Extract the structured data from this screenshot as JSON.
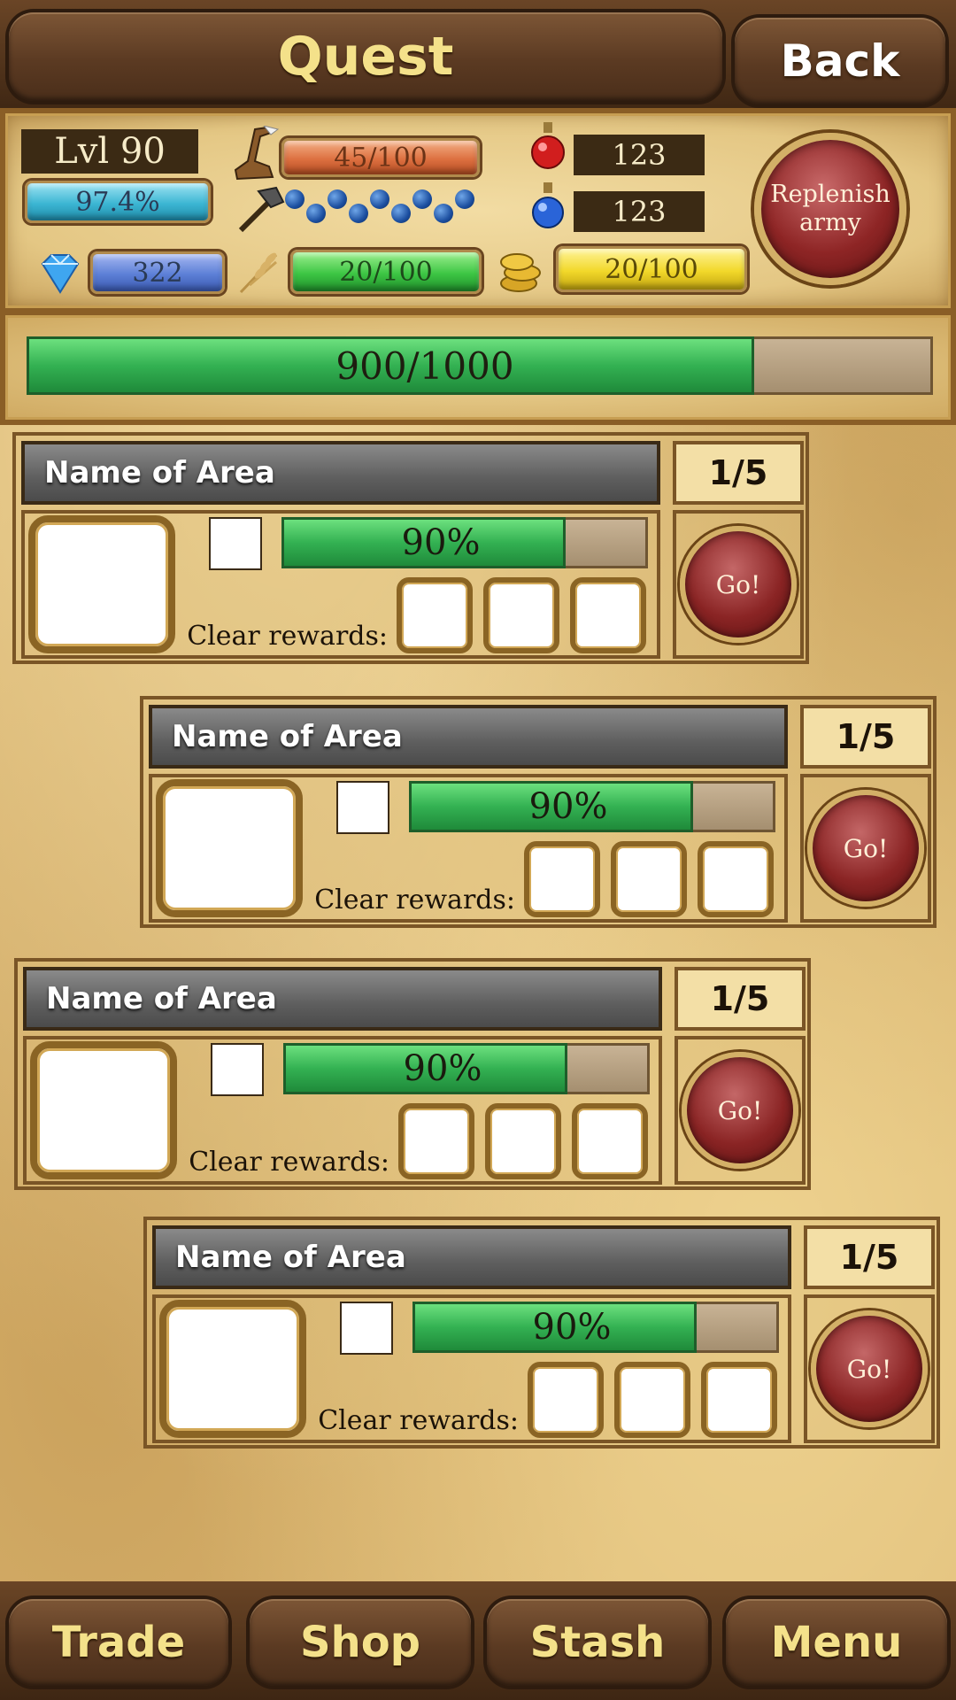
{
  "header": {
    "title": "Quest",
    "back_label": "Back"
  },
  "player": {
    "level_label": "Lvl 90",
    "experience_percent_label": "97.4%",
    "stamina": "45/100",
    "gems": "322",
    "food": "20/100",
    "gold": "20/100",
    "red_potions": "123",
    "blue_potions": "123",
    "army_units_count": 9,
    "replenish_label": "Replenish army"
  },
  "xp_bar": {
    "label": "900/1000",
    "current": 900,
    "max": 1000
  },
  "quests": [
    {
      "area_name": "Name of Area",
      "count": "1/5",
      "progress_label": "90%",
      "progress": 0.9,
      "rewards_label": "Clear rewards:",
      "go_label": "Go!"
    },
    {
      "area_name": "Name of Area",
      "count": "1/5",
      "progress_label": "90%",
      "progress": 0.9,
      "rewards_label": "Clear rewards:",
      "go_label": "Go!"
    },
    {
      "area_name": "Name of Area",
      "count": "1/5",
      "progress_label": "90%",
      "progress": 0.9,
      "rewards_label": "Clear rewards:",
      "go_label": "Go!"
    },
    {
      "area_name": "Name of Area",
      "count": "1/5",
      "progress_label": "90%",
      "progress": 0.9,
      "rewards_label": "Clear rewards:",
      "go_label": "Go!"
    }
  ],
  "bottom_nav": {
    "trade_label": "Trade",
    "shop_label": "Shop",
    "stash_label": "Stash",
    "menu_label": "Menu"
  },
  "icons": {
    "stamina": "boot-icon",
    "army": "axe-icon",
    "gems": "diamond-icon",
    "food": "wheat-icon",
    "gold": "coins-icon",
    "red_potion": "red-potion-icon",
    "blue_potion": "blue-potion-icon"
  },
  "colors": {
    "progress_green": "#33b152",
    "go_red": "#8a2424",
    "title_gold": "#f4e18a"
  }
}
